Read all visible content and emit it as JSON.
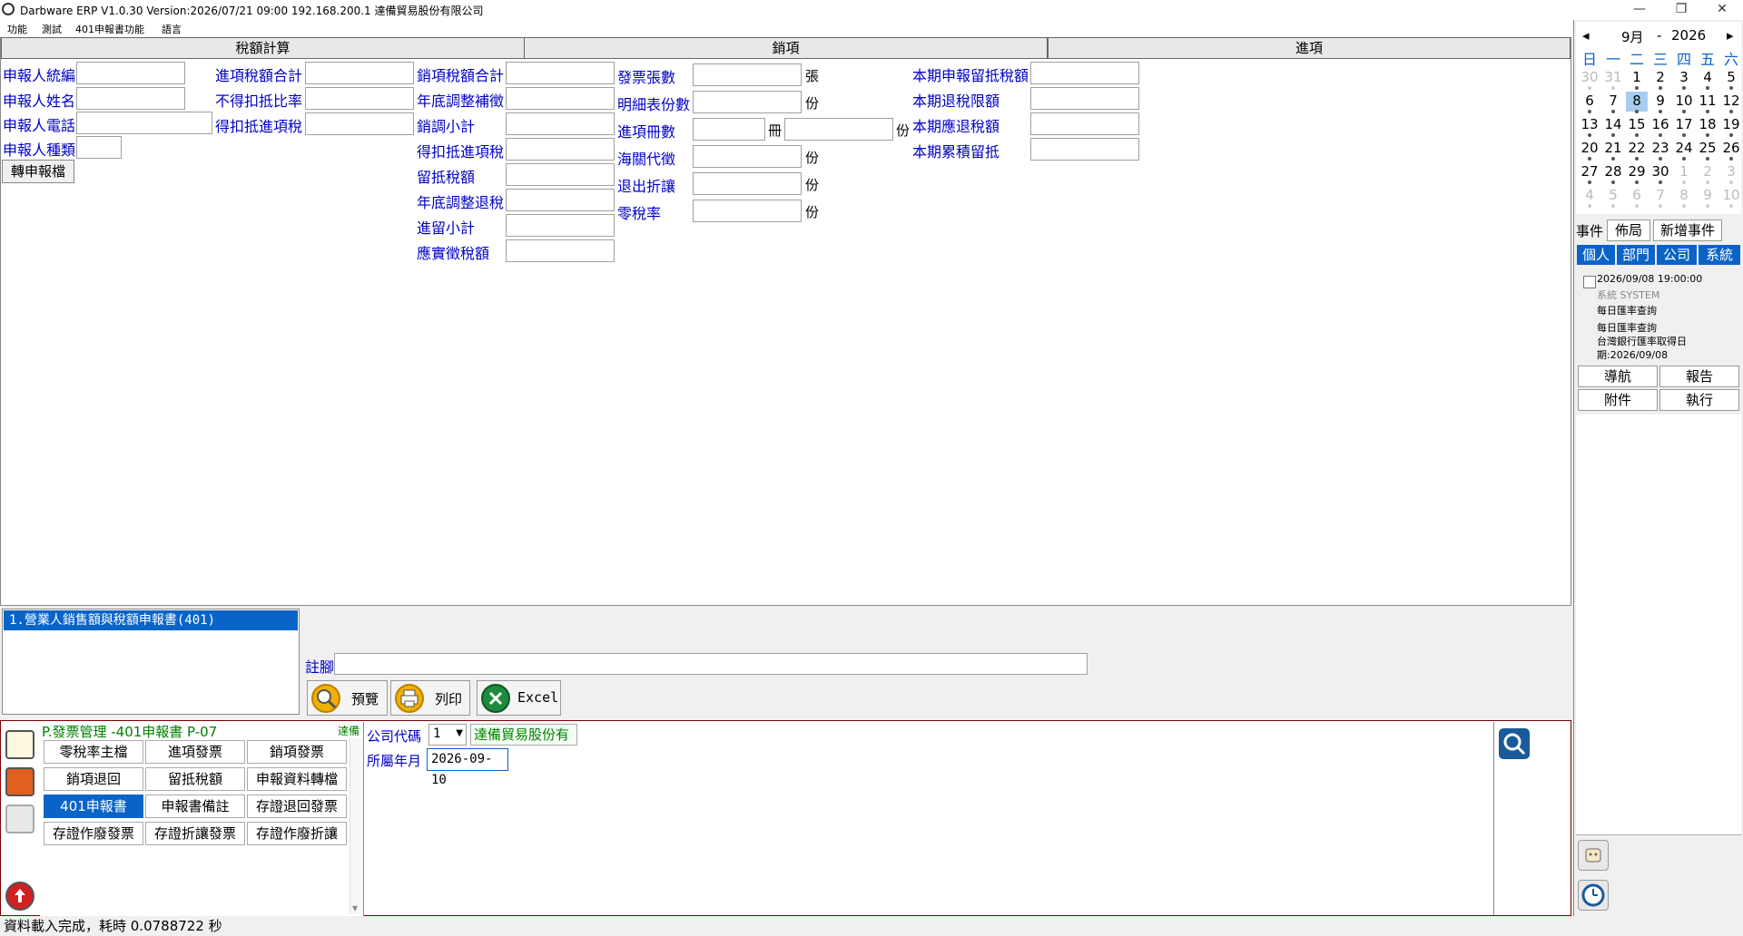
{
  "window": {
    "title": "Darbware ERP V1.0.30 Version:2026/07/21 09:00   192.168.200.1 達備貿易股份有限公司",
    "buttons": {
      "minimize": "—",
      "restore": "❐",
      "close": "✕"
    }
  },
  "menu": {
    "items": [
      "功能",
      "測試",
      "401申報書功能",
      "語言"
    ]
  },
  "tabs": [
    "稅額計算",
    "銷項",
    "進項"
  ],
  "form": {
    "col1": [
      "申報人統編",
      "申報人姓名",
      "申報人電話",
      "申報人種類"
    ],
    "col1_button": "轉申報檔",
    "col2": [
      "進項稅額合計",
      "不得扣抵比率",
      "得扣抵進項稅"
    ],
    "col3": [
      "銷項稅額合計",
      "年底調整補徵",
      "銷調小計",
      "得扣抵進項稅",
      "留抵稅額",
      "年底調整退稅",
      "進留小計",
      "應實徵稅額"
    ],
    "col4": [
      "發票張數",
      "明細表份數",
      "進項冊數",
      "海關代徵",
      "退出折讓",
      "零稅率"
    ],
    "col4_units": [
      "張",
      "份",
      "",
      "份",
      "份",
      "份"
    ],
    "col4_extra_units": [
      "冊",
      "份"
    ],
    "col5": [
      "本期申報留抵稅額",
      "本期退稅限額",
      "本期應退稅額",
      "本期累積留抵"
    ]
  },
  "report_list": {
    "items": [
      "1.營業人銷售額與稅額申報書(401)"
    ]
  },
  "footnote_label": "註腳",
  "actions": {
    "preview": "預覽",
    "print": "列印",
    "excel": "Excel"
  },
  "module": {
    "title": "P.發票管理 -401申報書  P-07",
    "company_short": "達備",
    "buttons": [
      [
        "零稅率主檔",
        "進項發票",
        "銷項發票"
      ],
      [
        "銷項退回",
        "留抵稅額",
        "申報資料轉檔"
      ],
      [
        "401申報書",
        "申報書備註",
        "存證退回發票"
      ],
      [
        "存證作廢發票",
        "存證折讓發票",
        "存證作廢折讓"
      ]
    ],
    "active_button": "401申報書"
  },
  "query": {
    "company_code_label": "公司代碼",
    "company_code_value": "1",
    "company_name": "達備貿易股份有",
    "period_label": "所屬年月",
    "period_value": "2026-09-10"
  },
  "status": "資料載入完成，耗時 0.0788722 秒",
  "calendar": {
    "month_label": "9月",
    "year_label": "2026",
    "separator": "-",
    "prev": "◂",
    "next": "▸",
    "weekdays": [
      "日",
      "一",
      "二",
      "三",
      "四",
      "五",
      "六"
    ],
    "weeks": [
      [
        [
          "30",
          true
        ],
        [
          "31",
          true
        ],
        [
          "1",
          false
        ],
        [
          "2",
          false
        ],
        [
          "3",
          false
        ],
        [
          "4",
          false
        ],
        [
          "5",
          false
        ]
      ],
      [
        [
          "6",
          false
        ],
        [
          "7",
          false
        ],
        [
          "8",
          false
        ],
        [
          "9",
          false
        ],
        [
          "10",
          false
        ],
        [
          "11",
          false
        ],
        [
          "12",
          false
        ]
      ],
      [
        [
          "13",
          false
        ],
        [
          "14",
          false
        ],
        [
          "15",
          false
        ],
        [
          "16",
          false
        ],
        [
          "17",
          false
        ],
        [
          "18",
          false
        ],
        [
          "19",
          false
        ]
      ],
      [
        [
          "20",
          false
        ],
        [
          "21",
          false
        ],
        [
          "22",
          false
        ],
        [
          "23",
          false
        ],
        [
          "24",
          false
        ],
        [
          "25",
          false
        ],
        [
          "26",
          false
        ]
      ],
      [
        [
          "27",
          false
        ],
        [
          "28",
          false
        ],
        [
          "29",
          false
        ],
        [
          "30",
          false
        ],
        [
          "1",
          true
        ],
        [
          "2",
          true
        ],
        [
          "3",
          true
        ]
      ],
      [
        [
          "4",
          true
        ],
        [
          "5",
          true
        ],
        [
          "6",
          true
        ],
        [
          "7",
          true
        ],
        [
          "8",
          true
        ],
        [
          "9",
          true
        ],
        [
          "10",
          true
        ]
      ]
    ],
    "selected_day": "8"
  },
  "events": {
    "label": "事件",
    "layout_button": "佈局",
    "new_button": "新增事件",
    "categories": [
      "個人",
      "部門",
      "公司",
      "系統"
    ],
    "item": {
      "datetime": "2026/09/08 19:00:00",
      "source": "系統  SYSTEM",
      "title": "每日匯率查詢",
      "body1": "每日匯率查詢",
      "body2": "台灣銀行匯率取得日",
      "body3": "期:2026/09/08"
    },
    "buttons": [
      "導航",
      "報告",
      "附件",
      "執行"
    ]
  },
  "colors": {
    "accent": "#0a64c8",
    "label_blue": "#0000c8",
    "module_green": "#008000",
    "border_red": "#800000"
  }
}
